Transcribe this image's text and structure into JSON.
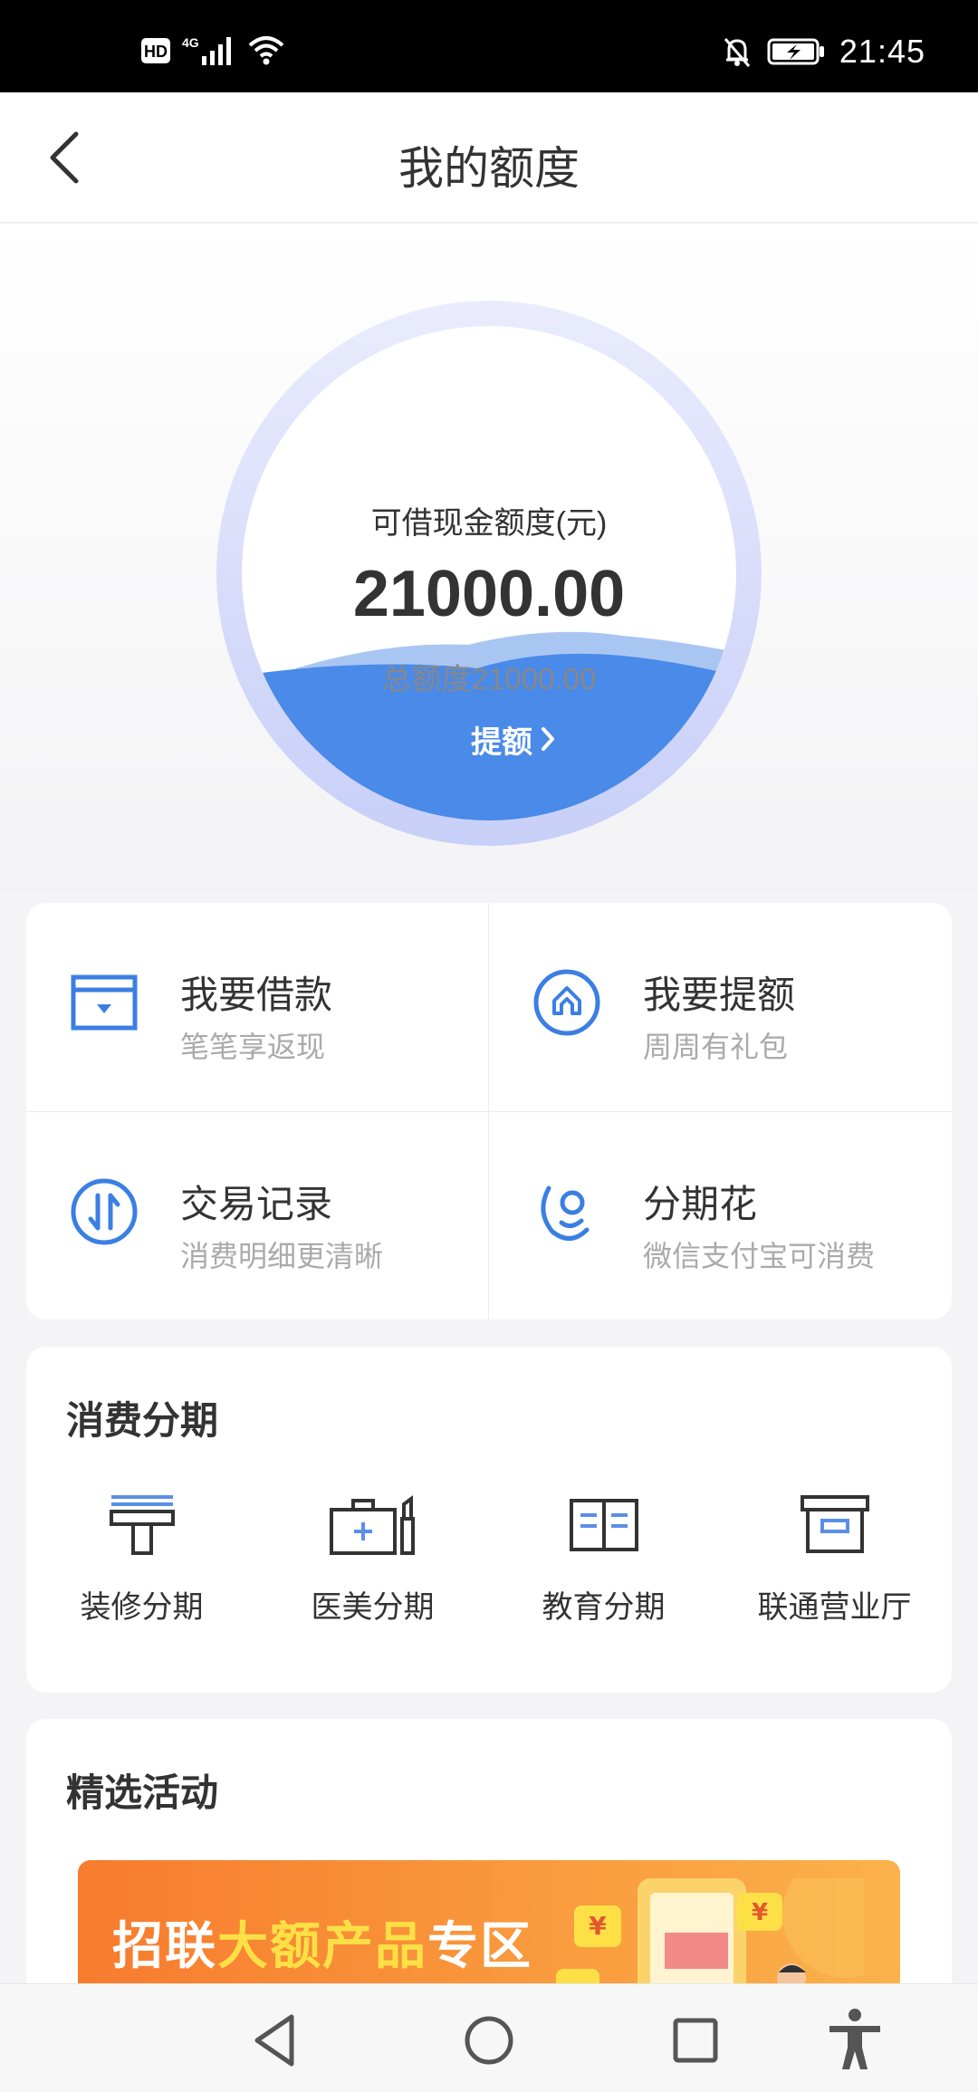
{
  "status_bar": {
    "left_icons": [
      "hd-icon",
      "4g-signal-icon",
      "wifi-icon"
    ],
    "right_icons": [
      "mute-bell-icon",
      "battery-charging-icon"
    ],
    "time": "21:45",
    "hd": "HD",
    "network": "4G"
  },
  "header": {
    "title": "我的额度"
  },
  "credit": {
    "available_label": "可借现金额度(元)",
    "available_amount": "21000.00",
    "total_line": "总额度21000.00",
    "raise_button": "提额"
  },
  "quick_actions": [
    {
      "title": "我要借款",
      "subtitle": "笔笔享返现",
      "icon": "wallet-icon"
    },
    {
      "title": "我要提额",
      "subtitle": "周周有礼包",
      "icon": "raise-limit-icon"
    },
    {
      "title": "交易记录",
      "subtitle": "消费明细更清晰",
      "icon": "transfer-record-icon"
    },
    {
      "title": "分期花",
      "subtitle": "微信支付宝可消费",
      "icon": "installment-smile-icon"
    }
  ],
  "installments": {
    "title": "消费分期",
    "items": [
      {
        "label": "装修分期",
        "icon": "paint-roller-icon"
      },
      {
        "label": "医美分期",
        "icon": "medical-kit-icon"
      },
      {
        "label": "教育分期",
        "icon": "book-icon"
      },
      {
        "label": "联通营业厅",
        "icon": "store-box-icon"
      }
    ]
  },
  "activities": {
    "title": "精选活动",
    "banner": {
      "part1": "招联",
      "part2": "大额产品",
      "part3": "专区"
    }
  },
  "bottom_nav": [
    "back-triangle-icon",
    "home-circle-icon",
    "recents-square-icon",
    "accessibility-icon"
  ],
  "colors": {
    "accent": "#4a8ae8",
    "banner_start": "#f77b2e",
    "banner_end": "#fbb24a",
    "banner_highlight": "#fde046"
  }
}
